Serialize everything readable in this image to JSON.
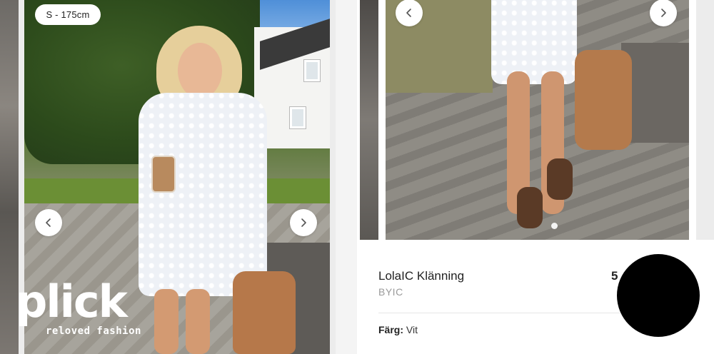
{
  "left_listing": {
    "size_badge": "S - 175cm",
    "prev_icon": "chevron-left-icon",
    "next_icon": "chevron-right-icon"
  },
  "logo": {
    "word": "plick",
    "tagline": "reloved fashion"
  },
  "right_listing": {
    "prev_icon": "chevron-left-icon",
    "next_icon": "chevron-right-icon",
    "product": {
      "title": "LolaIC Klänning",
      "brand": "BYIC",
      "price_partial": "5",
      "color_label": "Färg:",
      "color_value": "Vit"
    }
  },
  "colors": {
    "nav_button_bg": "#ffffff",
    "brand_text": "#9a9a9a",
    "redaction": "#000000"
  }
}
